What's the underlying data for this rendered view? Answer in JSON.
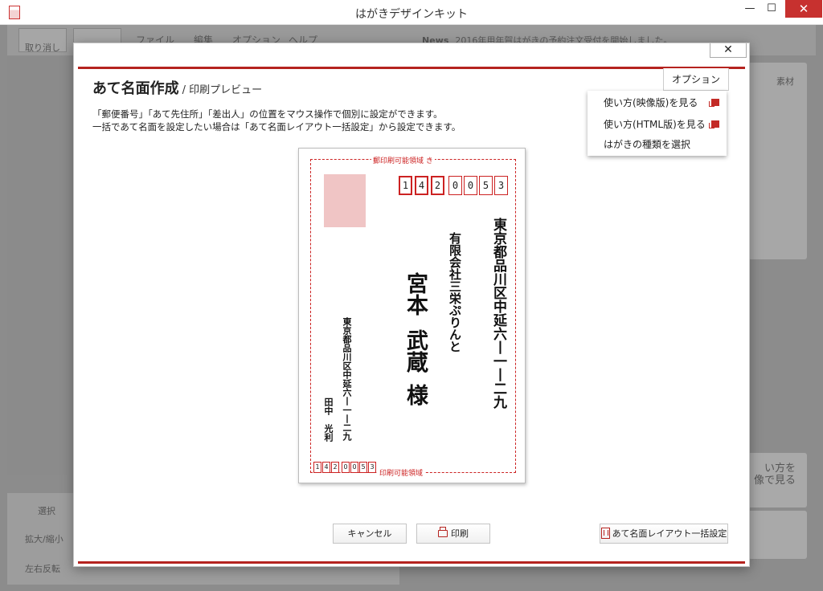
{
  "window": {
    "title": "はがきデザインキット",
    "minimize_glyph": "—",
    "maximize_glyph": "☐",
    "close_glyph": "✕"
  },
  "background_app": {
    "undo_label": "取り消し",
    "tabs": [
      "ファイル",
      "編集",
      "オプション",
      "ヘルプ"
    ],
    "news_label": "News",
    "news_text": "2016年用年賀はがきの予約注文受付を開始しました。",
    "material_label": "素材",
    "tool_select_label": "選択",
    "zoom_label": "拡大/縮小",
    "flip_label": "左右反転",
    "howto_card_text": "い方を\n像で見る"
  },
  "dialog": {
    "close_glyph": "✕",
    "title": "あて名面作成",
    "subtitle": "/ 印刷プレビュー",
    "description_line1": "「郵便番号」「あて先住所」「差出人」の位置をマウス操作で個別に設定ができます。",
    "description_line2": "一括であて名面を設定したい場合は「あて名面レイアウト一括設定」から設定できます。",
    "option_button": "オプション",
    "option_menu": [
      {
        "label": "使い方(映像版)を見る"
      },
      {
        "label": "使い方(HTML版)を見る"
      },
      {
        "label": "はがきの種類を選択"
      }
    ],
    "cancel_button": "キャンセル",
    "print_button": "印刷",
    "layout_button": "あて名面レイアウト一括設定"
  },
  "postcard": {
    "print_area_label": "印刷可能領域",
    "top_marker": "郵",
    "top_marker2": "き",
    "recipient_zip": [
      "1",
      "4",
      "2",
      "0",
      "0",
      "5",
      "3"
    ],
    "recipient_address": "東京都品川区中延六丨一丨二九",
    "recipient_company": "有限会社三栄ぷりんと",
    "recipient_name_family": "宮本",
    "recipient_name_given": "武蔵",
    "recipient_honorific": "様",
    "sender_address": "東京都品川区中延六丨一丨二九",
    "sender_name": "田中　光利",
    "sender_zip": [
      "1",
      "4",
      "2",
      "0",
      "0",
      "5",
      "3"
    ]
  },
  "colors": {
    "accent": "#b5231f",
    "print_area": "#cc2222",
    "stamp": "#f0c5c5",
    "close_red": "#c7312f"
  }
}
